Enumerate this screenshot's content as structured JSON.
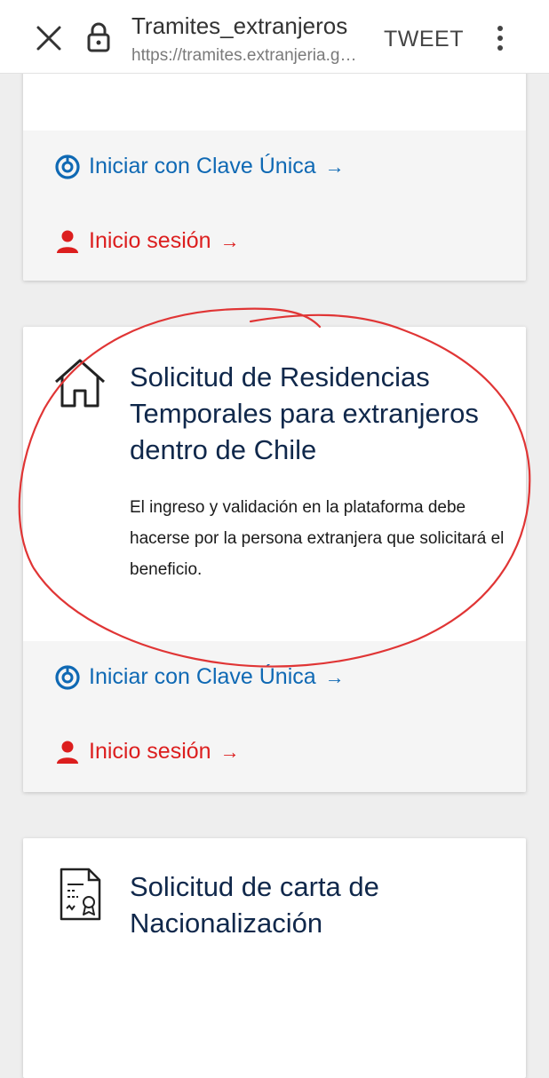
{
  "browser": {
    "page_title": "Tramites_extranjeros",
    "url": "https://tramites.extranjeria.gob.cl",
    "tweet_label": "TWEET"
  },
  "cards": [
    {
      "actions": {
        "clave_unica": "Iniciar con Clave Única",
        "inicio_sesion": "Inicio sesión",
        "arrow": "→"
      }
    },
    {
      "icon": "house-icon",
      "title": "Solicitud de Residencias Temporales para extranjeros dentro de Chile",
      "description": "El ingreso y validación en la plataforma debe hacerse por la persona extranjera que solicitará el beneficio.",
      "actions": {
        "clave_unica": "Iniciar con Clave Única",
        "inicio_sesion": "Inicio sesión",
        "arrow": "→"
      }
    },
    {
      "icon": "certificate-document-icon",
      "title": "Solicitud de carta de Nacionalización"
    }
  ],
  "colors": {
    "link_blue": "#0f69b4",
    "link_red": "#dc1e1e",
    "title_navy": "#10284b",
    "annotation_red": "#e03535"
  }
}
